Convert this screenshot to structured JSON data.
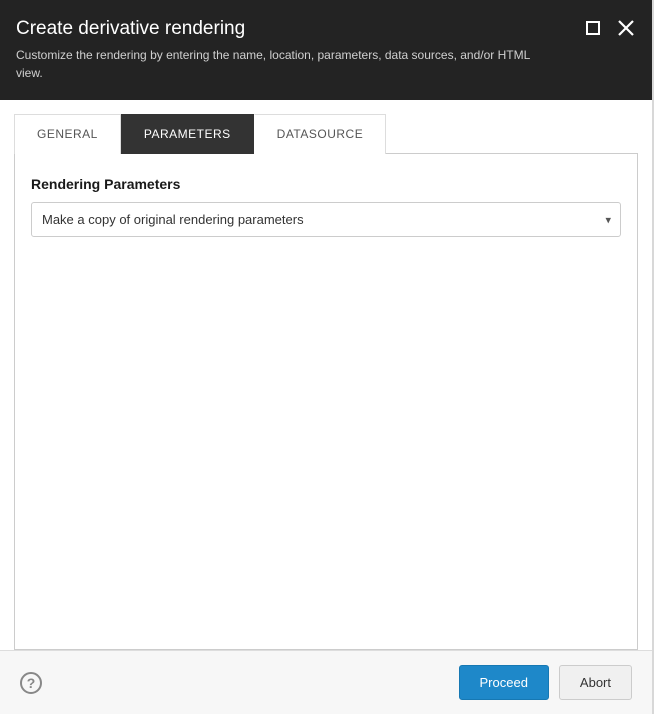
{
  "header": {
    "title": "Create derivative rendering",
    "subtitle": "Customize the rendering by entering the name, location, parameters, data sources, and/or HTML view."
  },
  "tabs": {
    "general": "GENERAL",
    "parameters": "PARAMETERS",
    "datasource": "DATASOURCE"
  },
  "form": {
    "rendering_params_label": "Rendering Parameters",
    "rendering_params_value": "Make a copy of original rendering parameters"
  },
  "footer": {
    "help": "?",
    "proceed": "Proceed",
    "abort": "Abort"
  }
}
